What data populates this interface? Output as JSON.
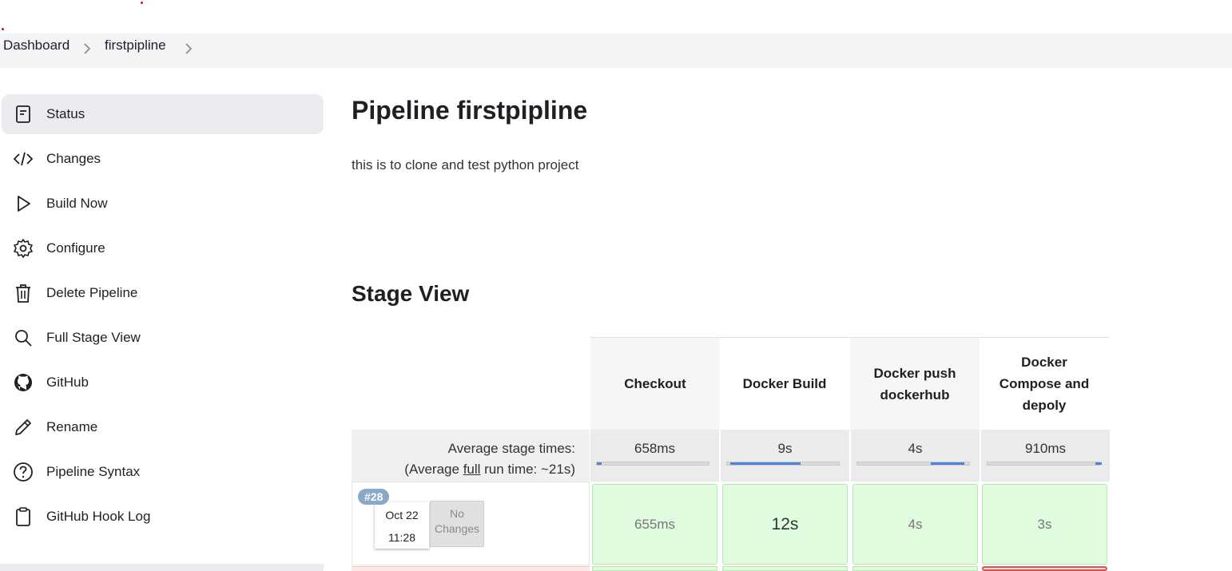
{
  "breadcrumb": {
    "items": [
      "Dashboard",
      "firstpipline"
    ]
  },
  "sidebar": {
    "items": [
      {
        "label": "Status",
        "icon": "status-icon"
      },
      {
        "label": "Changes",
        "icon": "code-icon"
      },
      {
        "label": "Build Now",
        "icon": "play-icon"
      },
      {
        "label": "Configure",
        "icon": "gear-icon"
      },
      {
        "label": "Delete Pipeline",
        "icon": "trash-icon"
      },
      {
        "label": "Full Stage View",
        "icon": "search-icon"
      },
      {
        "label": "GitHub",
        "icon": "github-icon"
      },
      {
        "label": "Rename",
        "icon": "pencil-icon"
      },
      {
        "label": "Pipeline Syntax",
        "icon": "help-icon"
      },
      {
        "label": "GitHub Hook Log",
        "icon": "clipboard-icon"
      }
    ]
  },
  "main": {
    "title": "Pipeline firstpipline",
    "description": "this is to clone and test python project",
    "stage_view_title": "Stage View"
  },
  "stage_view": {
    "stages": [
      "Checkout",
      "Docker Build",
      "Docker push dockerhub",
      "Docker Compose and depoly"
    ],
    "average_label": "Average stage times:",
    "average_full_prefix": "(Average ",
    "average_full_word": "full",
    "average_full_suffix": " run time: ~21s)",
    "average_times": [
      "658ms",
      "9s",
      "4s",
      "910ms"
    ],
    "builds": [
      {
        "number": "#28",
        "date": "Oct 22",
        "time": "11:28",
        "changes": "No Changes",
        "stage_times": [
          "655ms",
          "12s",
          "4s",
          "3s"
        ]
      }
    ]
  },
  "colors": {
    "success_cell": "#e1fbdf",
    "progress_fill": "#4a86d8",
    "badge": "#8aa9c9"
  }
}
